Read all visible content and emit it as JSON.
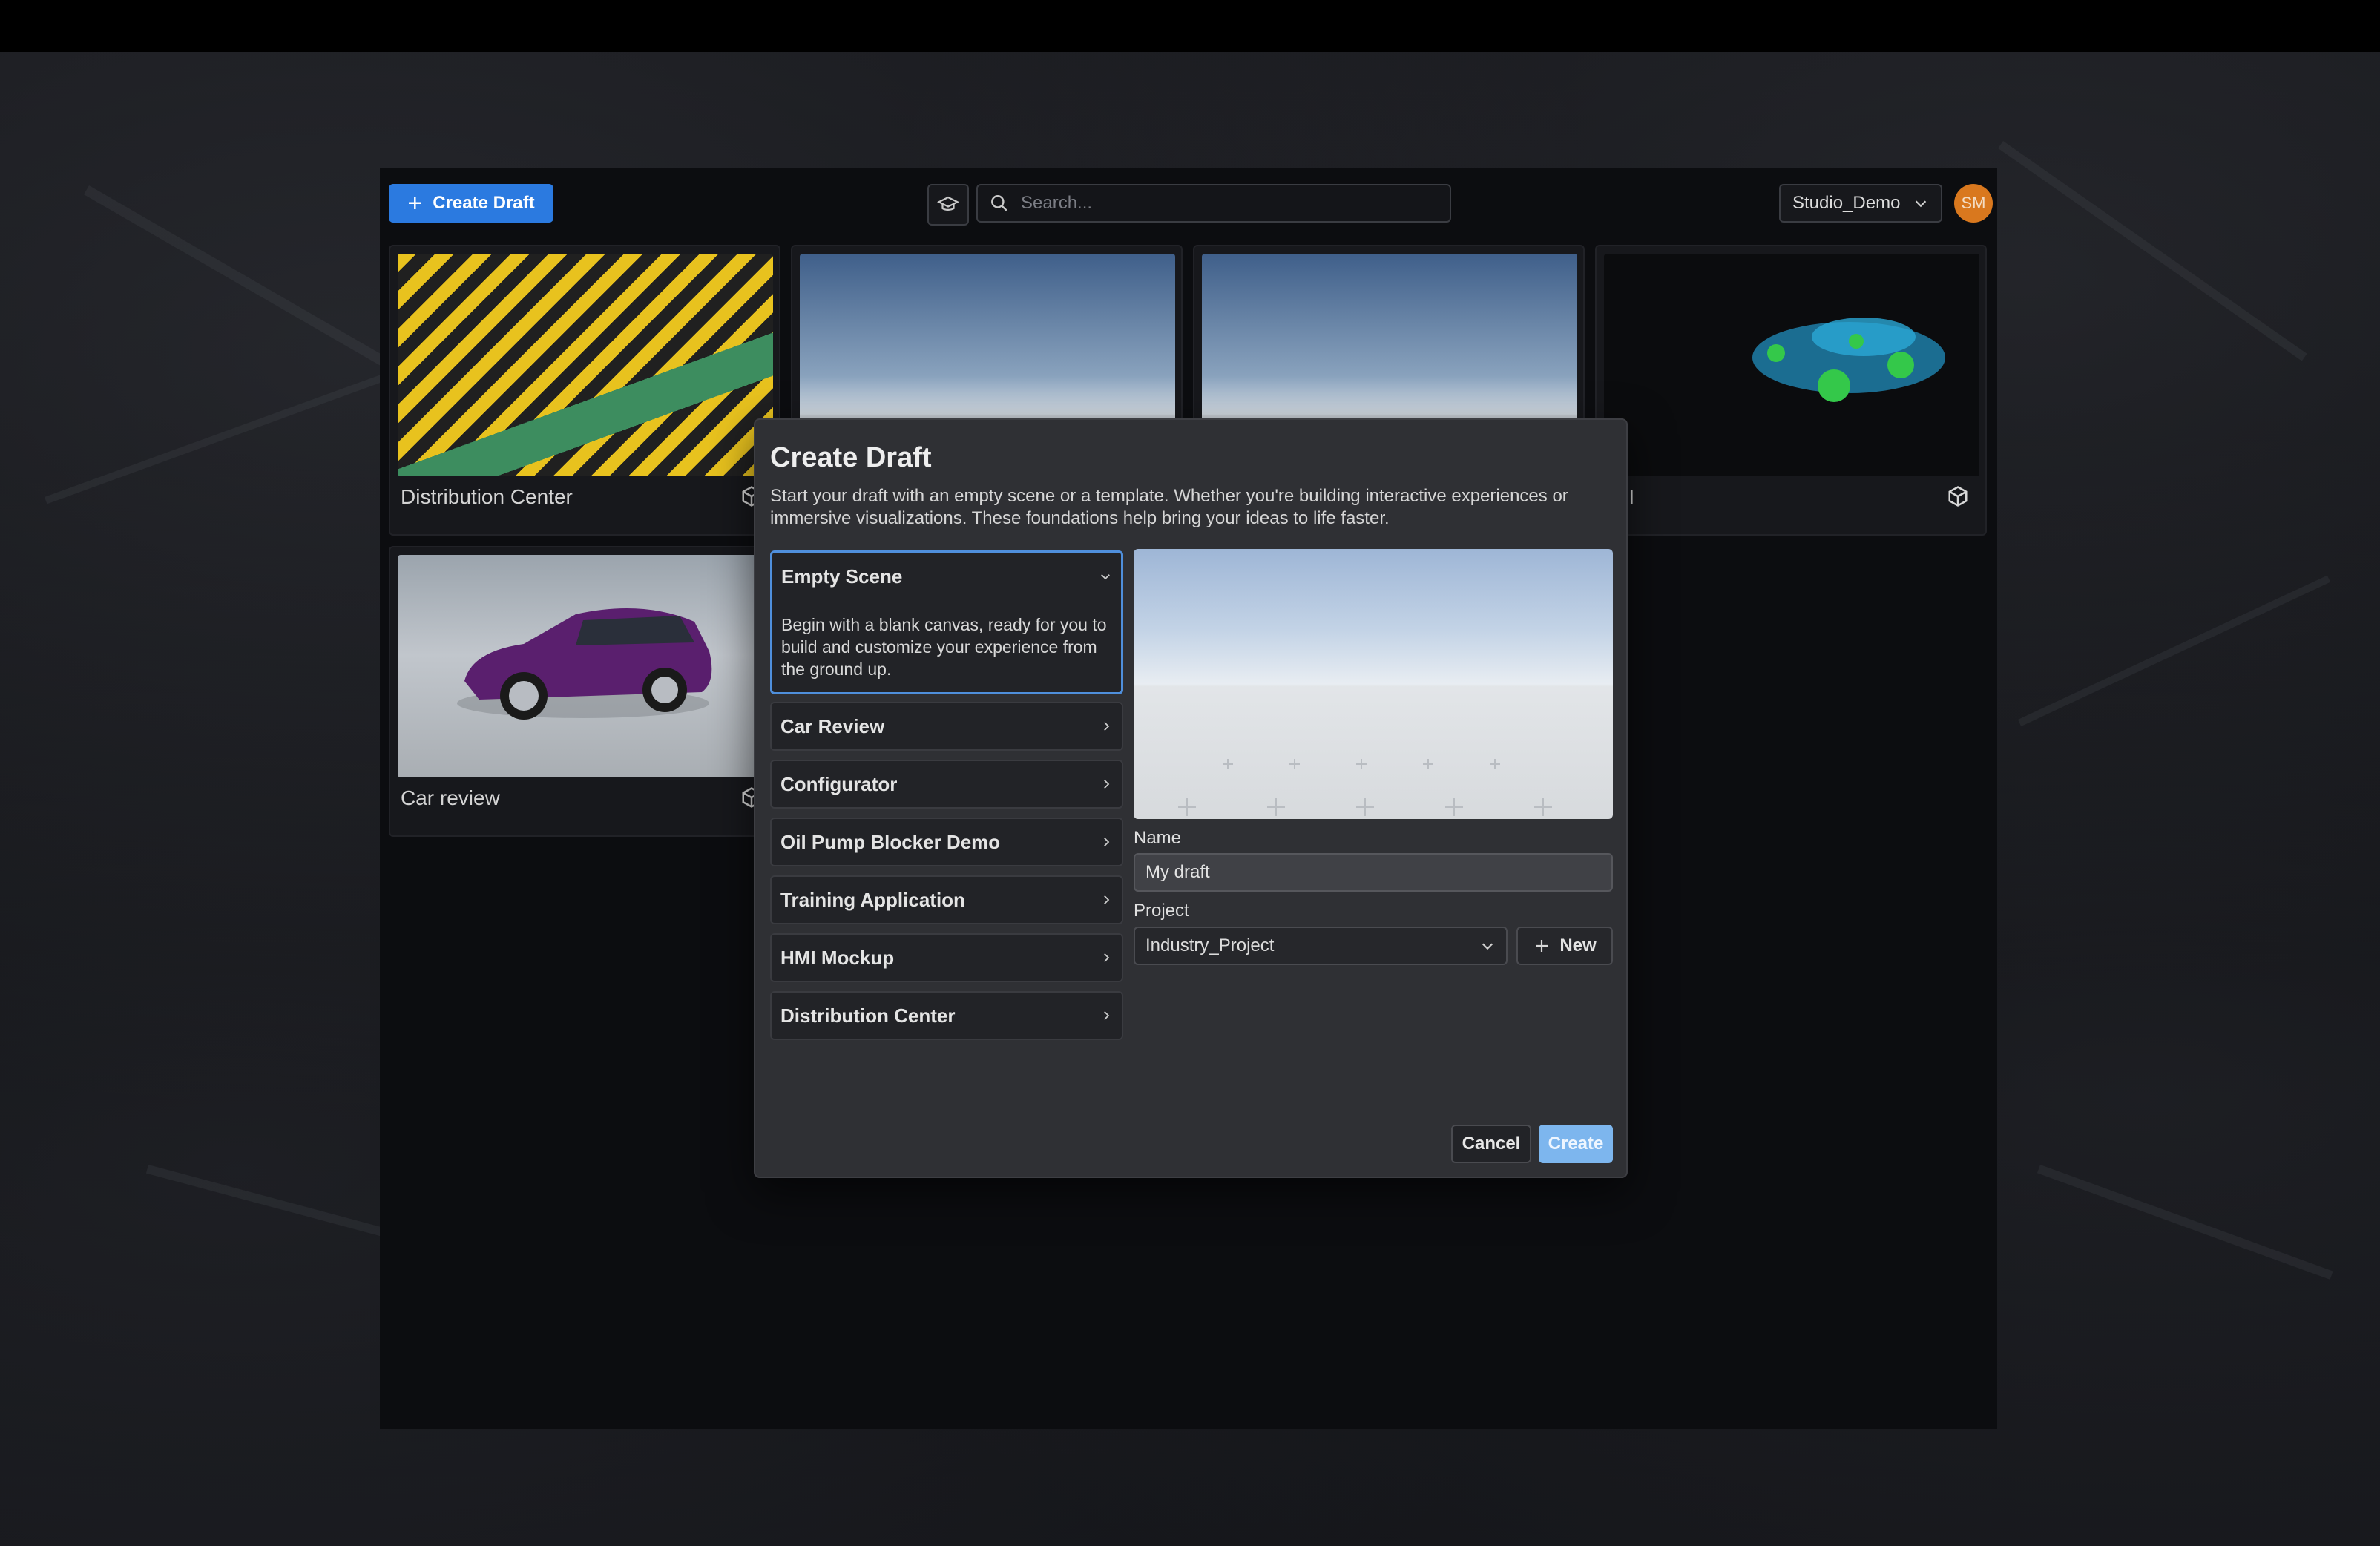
{
  "toolbar": {
    "create_draft_label": "Create Draft",
    "search_placeholder": "Search...",
    "organization": "Studio_Demo",
    "avatar_initials": "SM",
    "accent_color": "#2b7ae0"
  },
  "drafts": [
    {
      "title": "Distribution Center",
      "icon": "unity-icon"
    },
    {
      "title": "",
      "icon": ""
    },
    {
      "title": "",
      "icon": ""
    },
    {
      "title": "MI",
      "icon": "unity-icon"
    },
    {
      "title": "Car review",
      "icon": "unity-icon"
    }
  ],
  "modal": {
    "title": "Create Draft",
    "description": "Start your draft with an empty scene or a template. Whether you're building interactive experiences or immersive visualizations. These foundations help bring your ideas to life faster.",
    "templates": [
      {
        "label": "Empty Scene",
        "expanded": true,
        "description": "Begin with a blank canvas, ready for you to build and customize your experience from the ground up."
      },
      {
        "label": "Car Review"
      },
      {
        "label": "Configurator"
      },
      {
        "label": "Oil Pump Blocker Demo"
      },
      {
        "label": "Training Application"
      },
      {
        "label": "HMI Mockup"
      },
      {
        "label": "Distribution Center"
      }
    ],
    "name_label": "Name",
    "name_value": "My draft",
    "project_label": "Project",
    "project_value": "Industry_Project",
    "new_label": "New",
    "cancel_label": "Cancel",
    "create_label": "Create"
  }
}
